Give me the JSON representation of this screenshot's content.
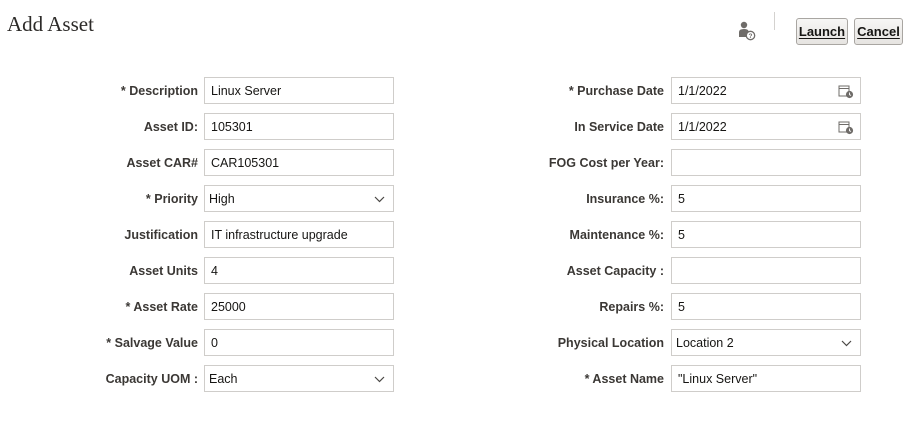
{
  "page": {
    "title": "Add Asset"
  },
  "toolbar": {
    "help_icon": "user-help-icon",
    "launch_label": "Launch",
    "cancel_label": "Cancel"
  },
  "left": {
    "description": {
      "label": "* Description",
      "value": "Linux Server"
    },
    "asset_id": {
      "label": "Asset ID:",
      "value": "105301"
    },
    "asset_car": {
      "label": "Asset CAR#",
      "value": "CAR105301"
    },
    "priority": {
      "label": "* Priority",
      "value": "High"
    },
    "justification": {
      "label": "Justification",
      "value": "IT infrastructure upgrade"
    },
    "asset_units": {
      "label": "Asset Units",
      "value": "4"
    },
    "asset_rate": {
      "label": "* Asset Rate",
      "value": "25000"
    },
    "salvage_value": {
      "label": "* Salvage Value",
      "value": "0"
    },
    "capacity_uom": {
      "label": "Capacity UOM :",
      "value": "Each"
    }
  },
  "right": {
    "purchase_date": {
      "label": "* Purchase Date",
      "value": "1/1/2022"
    },
    "in_service_date": {
      "label": "In Service Date",
      "value": "1/1/2022"
    },
    "fog_cost": {
      "label": "FOG Cost per Year:",
      "value": ""
    },
    "insurance": {
      "label": "Insurance %:",
      "value": "5"
    },
    "maintenance": {
      "label": "Maintenance %:",
      "value": "5"
    },
    "asset_capacity": {
      "label": "Asset Capacity :",
      "value": ""
    },
    "repairs": {
      "label": "Repairs %:",
      "value": "5"
    },
    "physical_location": {
      "label": "Physical Location",
      "value": "Location 2"
    },
    "asset_name": {
      "label": "* Asset Name",
      "value": "\"Linux Server\""
    }
  },
  "colors": {
    "border": "#cfcdca",
    "label": "#3b3835",
    "button_border": "#a9a6a2"
  }
}
